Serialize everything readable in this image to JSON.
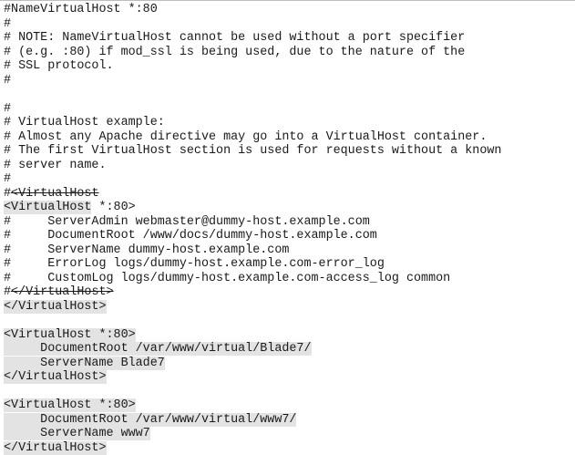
{
  "document": {
    "lines": [
      [
        {
          "text": "#NameVirtualHost *:80"
        }
      ],
      [
        {
          "text": "#"
        }
      ],
      [
        {
          "text": "# NOTE: NameVirtualHost cannot be used without a port specifier"
        }
      ],
      [
        {
          "text": "# (e.g. :80) if mod_ssl is being used, due to the nature of the"
        }
      ],
      [
        {
          "text": "# SSL protocol."
        }
      ],
      [
        {
          "text": "#"
        }
      ],
      [
        {
          "text": ""
        }
      ],
      [
        {
          "text": "#"
        }
      ],
      [
        {
          "text": "# VirtualHost example:"
        }
      ],
      [
        {
          "text": "# Almost any Apache directive may go into a VirtualHost container."
        }
      ],
      [
        {
          "text": "# The first VirtualHost section is used for requests without a known"
        }
      ],
      [
        {
          "text": "# server name."
        }
      ],
      [
        {
          "text": "#"
        }
      ],
      [
        {
          "text": "#"
        },
        {
          "text": "<VirtualHost",
          "strike": true
        }
      ],
      [
        {
          "text": "<VirtualHost",
          "hl": true
        },
        {
          "text": " *:80>"
        }
      ],
      [
        {
          "text": "#     ServerAdmin webmaster@dummy-host.example.com"
        }
      ],
      [
        {
          "text": "#     DocumentRoot /www/docs/dummy-host.example.com"
        }
      ],
      [
        {
          "text": "#     ServerName dummy-host.example.com"
        }
      ],
      [
        {
          "text": "#     ErrorLog logs/dummy-host.example.com-error_log"
        }
      ],
      [
        {
          "text": "#     CustomLog logs/dummy-host.example.com-access_log common"
        }
      ],
      [
        {
          "text": "#"
        },
        {
          "text": "</VirtualHost>",
          "strike": true
        }
      ],
      [
        {
          "text": "</VirtualHost>",
          "hl": true
        }
      ],
      [
        {
          "text": ""
        }
      ],
      [
        {
          "text": "<VirtualHost *:80>",
          "hl": true
        }
      ],
      [
        {
          "text": "     DocumentRoot /var/www/virtual/Blade7/",
          "hl": true
        }
      ],
      [
        {
          "text": "     ServerName Blade7",
          "hl": true
        }
      ],
      [
        {
          "text": "</VirtualHost>",
          "hl": true
        }
      ],
      [
        {
          "text": ""
        }
      ],
      [
        {
          "text": "<VirtualHost *:80>",
          "hl": true
        }
      ],
      [
        {
          "text": "     DocumentRoot /var/www/virtual/www7/",
          "hl": true
        }
      ],
      [
        {
          "text": "     ServerName www7",
          "hl": true
        }
      ],
      [
        {
          "text": "</VirtualHost>",
          "hl": true
        }
      ]
    ]
  }
}
